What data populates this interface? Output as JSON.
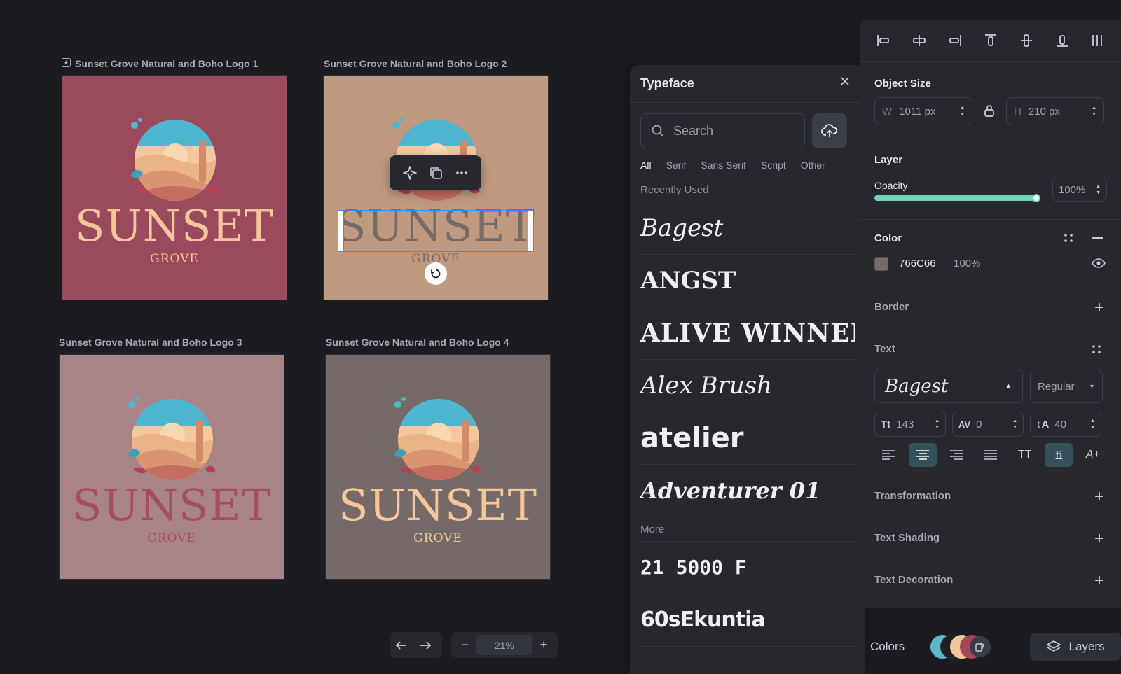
{
  "canvas": {
    "cards": [
      {
        "label": "Sunset Grove Natural and Boho Logo 1",
        "bg": "#9b4a5e",
        "text_color": "#f4c69a",
        "word": "SUNSET",
        "sub": "GROVE"
      },
      {
        "label": "Sunset Grove Natural and Boho Logo 2",
        "bg": "#bf9a80",
        "text_color": "#766c66",
        "word": "SUNSET",
        "sub": "GROVE"
      },
      {
        "label": "Sunset Grove Natural and Boho Logo 3",
        "bg": "#a98487",
        "text_color": "#a54e5f",
        "word": "SUNSET",
        "sub": "GROVE"
      },
      {
        "label": "Sunset Grove Natural and Boho Logo 4",
        "bg": "#756a67",
        "text_color": "#f4c69a",
        "word": "SUNSET",
        "sub": "GROVE"
      }
    ],
    "floating_toolbar": {
      "ai": "sparkle-icon",
      "duplicate": "copy-icon",
      "more": "ellipsis-icon"
    }
  },
  "bottom_toolbar": {
    "undo": "undo-icon",
    "redo": "redo-icon",
    "zoom_out": "−",
    "zoom": "21%",
    "zoom_in": "+"
  },
  "typeface": {
    "title": "Typeface",
    "search_placeholder": "Search",
    "tabs": [
      "All",
      "Serif",
      "Sans Serif",
      "Script",
      "Other"
    ],
    "recently_used_label": "Recently Used",
    "recent_fonts": [
      "Bagest",
      "ANGST",
      "ALIVE WINNER",
      "Alex Brush",
      "atelier",
      "Adventurer 01"
    ],
    "more_label": "More",
    "more_fonts": [
      "21 5000 F",
      "60sEkuntia"
    ]
  },
  "properties": {
    "object_size": {
      "title": "Object Size",
      "w_label": "W",
      "w_value": "1011 px",
      "h_label": "H",
      "h_value": "210 px"
    },
    "layer": {
      "title": "Layer",
      "opacity_label": "Opacity",
      "opacity_value": "100%",
      "opacity_level": 1.0
    },
    "color": {
      "title": "Color",
      "hex": "766C66",
      "alpha": "100%",
      "swatch": "#766c66"
    },
    "border": {
      "title": "Border"
    },
    "text": {
      "title": "Text",
      "font": "Bagest",
      "weight": "Regular",
      "size": "143",
      "tracking": "0",
      "leading": "40",
      "align_active": "center"
    },
    "transformation": {
      "title": "Transformation"
    },
    "text_shading": {
      "title": "Text Shading"
    },
    "text_decoration": {
      "title": "Text Decoration"
    }
  },
  "footer": {
    "colors_label": "Colors",
    "layers_label": "Layers"
  }
}
